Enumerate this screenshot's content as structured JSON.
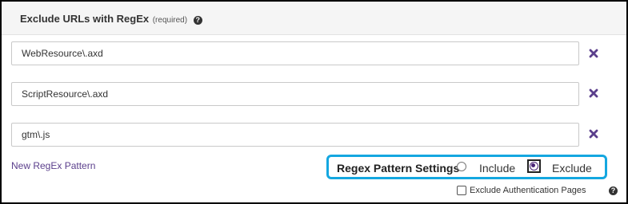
{
  "header": {
    "title": "Exclude URLs with RegEx",
    "required_note": "(required)",
    "help_icon_glyph": "?"
  },
  "patterns": [
    {
      "value": "WebResource\\.axd"
    },
    {
      "value": "ScriptResource\\.axd"
    },
    {
      "value": "gtm\\.js"
    }
  ],
  "new_pattern_link": "New RegEx Pattern",
  "regex_settings": {
    "label": "Regex Pattern Settings",
    "options": [
      {
        "label": "Include",
        "selected": false
      },
      {
        "label": "Exclude",
        "selected": true
      }
    ]
  },
  "auth": {
    "label": "Exclude Authentication Pages",
    "checked": false,
    "help_icon_glyph": "?"
  },
  "colors": {
    "remove_icon": "#5b3f8c",
    "link": "#5b3f8c",
    "highlight_border": "#14a7e0",
    "radio_selected": "#4a2478"
  }
}
